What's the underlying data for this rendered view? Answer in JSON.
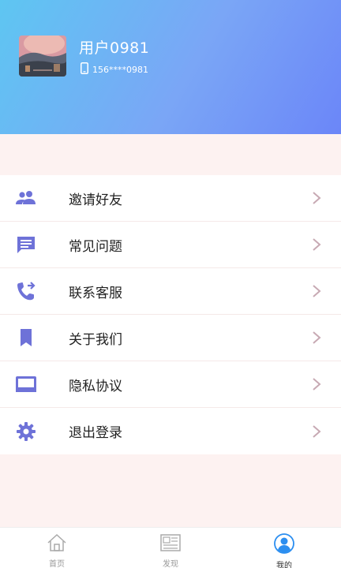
{
  "profile": {
    "username": "用户0981",
    "phone": "156****0981"
  },
  "menu": {
    "items": [
      {
        "label": "邀请好友",
        "icon": "people-icon"
      },
      {
        "label": "常见问题",
        "icon": "message-icon"
      },
      {
        "label": "联系客服",
        "icon": "phone-forward-icon"
      },
      {
        "label": "关于我们",
        "icon": "bookmark-icon"
      },
      {
        "label": "隐私协议",
        "icon": "keyboard-icon"
      },
      {
        "label": "退出登录",
        "icon": "gear-icon"
      }
    ]
  },
  "tabbar": {
    "tabs": [
      {
        "label": "首页",
        "icon": "home-icon",
        "active": false
      },
      {
        "label": "发现",
        "icon": "news-icon",
        "active": false
      },
      {
        "label": "我的",
        "icon": "user-icon",
        "active": true
      }
    ]
  },
  "colors": {
    "accent": "#6e72d8",
    "header_start": "#5ec6f2",
    "header_end": "#6b86f8",
    "chevron": "#c7a9b3",
    "active_tab": "#2b8ef0"
  }
}
